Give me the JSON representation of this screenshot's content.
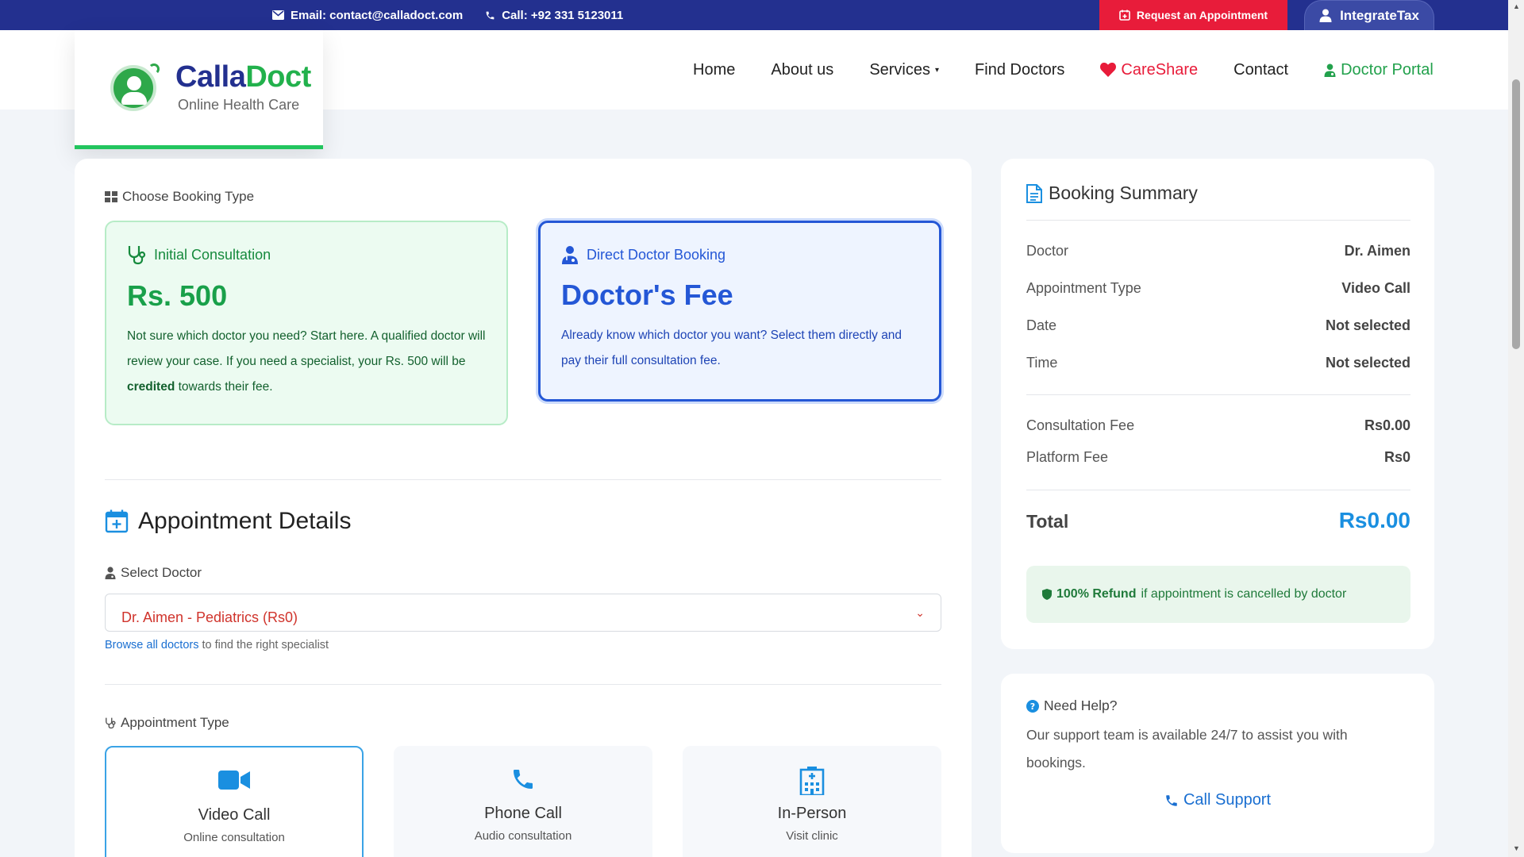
{
  "topbar": {
    "email": "Email: contact@calladoct.com",
    "phone": "Call: +92 331 5123011",
    "request_label": "Request an Appointment",
    "integrate_label": "IntegrateTax"
  },
  "brand": {
    "name_part1": "Calla",
    "name_part2": "Doct",
    "tagline": "Online Health Care"
  },
  "nav": {
    "home": "Home",
    "about": "About us",
    "services": "Services",
    "find_doctors": "Find Doctors",
    "careshare": "CareShare",
    "contact": "Contact",
    "doctor_portal": "Doctor Portal"
  },
  "booking": {
    "section_label": "Choose Booking Type",
    "initial": {
      "title": "Initial Consultation",
      "price": "Rs. 500",
      "desc_1": "Not sure which doctor you need? Start here. A qualified doctor will review your case. If you need a specialist, your Rs. 500 will be ",
      "desc_bold": "credited",
      "desc_2": " towards their fee."
    },
    "direct": {
      "title": "Direct Doctor Booking",
      "price": "Doctor's Fee",
      "desc": "Already know which doctor you want? Select them directly and pay their full consultation fee."
    }
  },
  "appointment": {
    "title": "Appointment Details",
    "doctor_label": "Select Doctor",
    "doctor_selected": "Dr. Aimen - Pediatrics (Rs0)",
    "browse_link": "Browse all doctors",
    "browse_rest": " to find the right specialist",
    "type_label": "Appointment Type",
    "types": [
      {
        "label": "Video Call",
        "sub": "Online consultation",
        "icon": "video-icon"
      },
      {
        "label": "Phone Call",
        "sub": "Audio consultation",
        "icon": "phone-icon"
      },
      {
        "label": "In-Person",
        "sub": "Visit clinic",
        "icon": "hospital-icon"
      }
    ]
  },
  "summary": {
    "title": "Booking Summary",
    "rows": [
      {
        "k": "Doctor",
        "v": "Dr. Aimen"
      },
      {
        "k": "Appointment Type",
        "v": "Video Call"
      },
      {
        "k": "Date",
        "v": "Not selected"
      },
      {
        "k": "Time",
        "v": "Not selected"
      }
    ],
    "fees": [
      {
        "k": "Consultation Fee",
        "v": "Rs0.00"
      },
      {
        "k": "Platform Fee",
        "v": "Rs0"
      }
    ],
    "total_label": "Total",
    "total_value": "Rs0.00",
    "refund_bold": "100% Refund",
    "refund_rest": " if appointment is cancelled by doctor"
  },
  "help": {
    "title": "Need Help?",
    "text": "Our support team is available 24/7 to assist you with bookings.",
    "call_label": "Call Support"
  },
  "colors": {
    "topbar": "#23308f",
    "request": "#e81c3a",
    "green": "#22b14c",
    "blue": "#2457d6",
    "accent": "#1a8fe0"
  }
}
